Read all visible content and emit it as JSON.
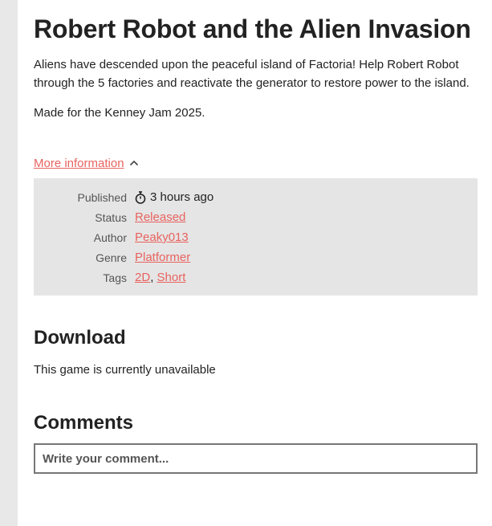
{
  "game": {
    "title": "Robert Robot and the Alien Invasion",
    "description": "Aliens have descended upon the peaceful island of Factoria! Help Robert Robot through the 5 factories and reactivate the generator to restore power to the island.",
    "jam_note": "Made for the Kenney Jam 2025."
  },
  "more_info": {
    "label": "More information",
    "icon": "chevron-up-icon"
  },
  "info_table": {
    "published": {
      "label": "Published",
      "value": "3 hours ago",
      "icon": "stopwatch-icon"
    },
    "status": {
      "label": "Status",
      "value": "Released"
    },
    "author": {
      "label": "Author",
      "value": "Peaky013"
    },
    "genre": {
      "label": "Genre",
      "value": "Platformer"
    },
    "tags": {
      "label": "Tags",
      "values": [
        "2D",
        "Short"
      ],
      "separator": ","
    }
  },
  "download": {
    "heading": "Download",
    "text": "This game is currently unavailable"
  },
  "comments": {
    "heading": "Comments",
    "placeholder": "Write your comment..."
  },
  "colors": {
    "link": "#e8635f",
    "info_background": "#e5e5e5",
    "page_background": "#ffffff",
    "side_background": "#e8e8e8"
  }
}
